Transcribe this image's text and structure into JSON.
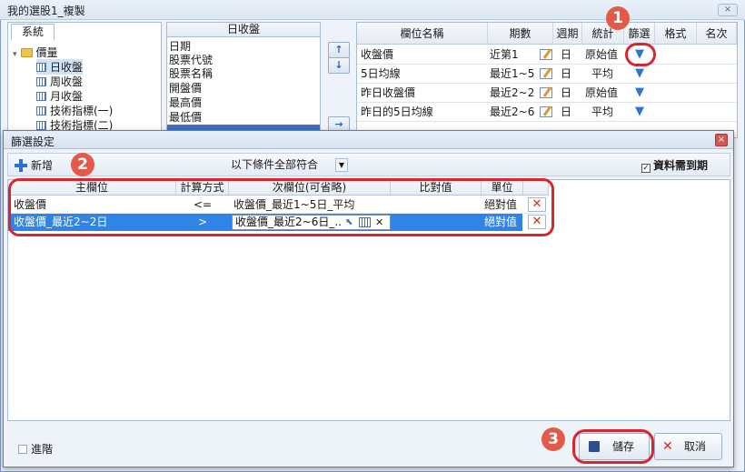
{
  "window": {
    "title": "我的選股1_複製",
    "close_label": "×"
  },
  "tree": {
    "tab": "系統",
    "root": "價量",
    "items": [
      "日收盤",
      "周收盤",
      "月收盤",
      "技術指標(一)",
      "技術指標(二)"
    ]
  },
  "field_list": {
    "header": "日收盤",
    "items": [
      "日期",
      "股票代號",
      "股票名稱",
      "開盤價",
      "最高價",
      "最低價"
    ]
  },
  "arrows": {
    "up": "↑",
    "down": "↓",
    "right": "→"
  },
  "columns_table": {
    "headers": [
      "欄位名稱",
      "期數",
      "週期",
      "統計",
      "篩選",
      "格式",
      "名次"
    ],
    "rows": [
      {
        "name": "收盤價",
        "period": "近第1",
        "cycle": "日",
        "stat": "原始值"
      },
      {
        "name": "5日均線",
        "period": "最近1~5",
        "cycle": "日",
        "stat": "平均"
      },
      {
        "name": "昨日收盤價",
        "period": "最近2~2",
        "cycle": "日",
        "stat": "原始值"
      },
      {
        "name": "昨日的5日均線",
        "period": "最近2~6",
        "cycle": "日",
        "stat": "平均"
      }
    ]
  },
  "dialog": {
    "title": "篩選設定",
    "close_label": "×",
    "add_label": "新增",
    "condition": "以下條件全部符合",
    "must_expire_label": "資料需到期",
    "must_expire_checked": "✓",
    "grid_headers": [
      "主欄位",
      "計算方式",
      "次欄位(可省略)",
      "比對值",
      "單位"
    ],
    "rows": [
      {
        "main": "收盤價",
        "op": "<=",
        "secondary": "收盤價_最近1~5日_平均",
        "compare": "",
        "unit": "絕對值",
        "delete": "✕"
      },
      {
        "main": "收盤價_最近2~2日",
        "op": ">",
        "secondary": "收盤價_最近2~6日_...",
        "compare": "",
        "unit": "絕對值",
        "delete": "✕"
      }
    ],
    "advanced_label": "進階",
    "save_label": "儲存",
    "cancel_label": "取消"
  },
  "annotations": [
    "1",
    "2",
    "3"
  ],
  "colors": {
    "accent": "#2f84e6",
    "callout": "#d8262f",
    "badge": "#e35a49"
  }
}
